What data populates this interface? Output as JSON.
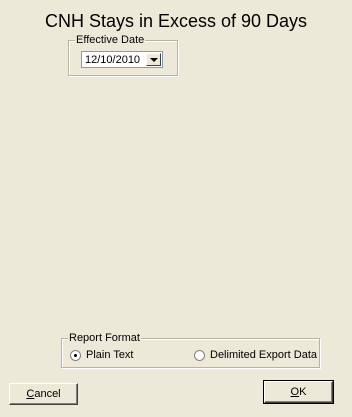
{
  "title": "CNH Stays in Excess of 90 Days",
  "effective_date": {
    "legend": "Effective Date",
    "value": "12/10/2010"
  },
  "report_format": {
    "legend": "Report Format",
    "options": [
      {
        "label": "Plain Text",
        "selected": true
      },
      {
        "label": "Delimited Export Data",
        "selected": false
      }
    ]
  },
  "buttons": {
    "cancel_access": "C",
    "cancel_rest": "ancel",
    "ok_access": "O",
    "ok_rest": "K"
  }
}
